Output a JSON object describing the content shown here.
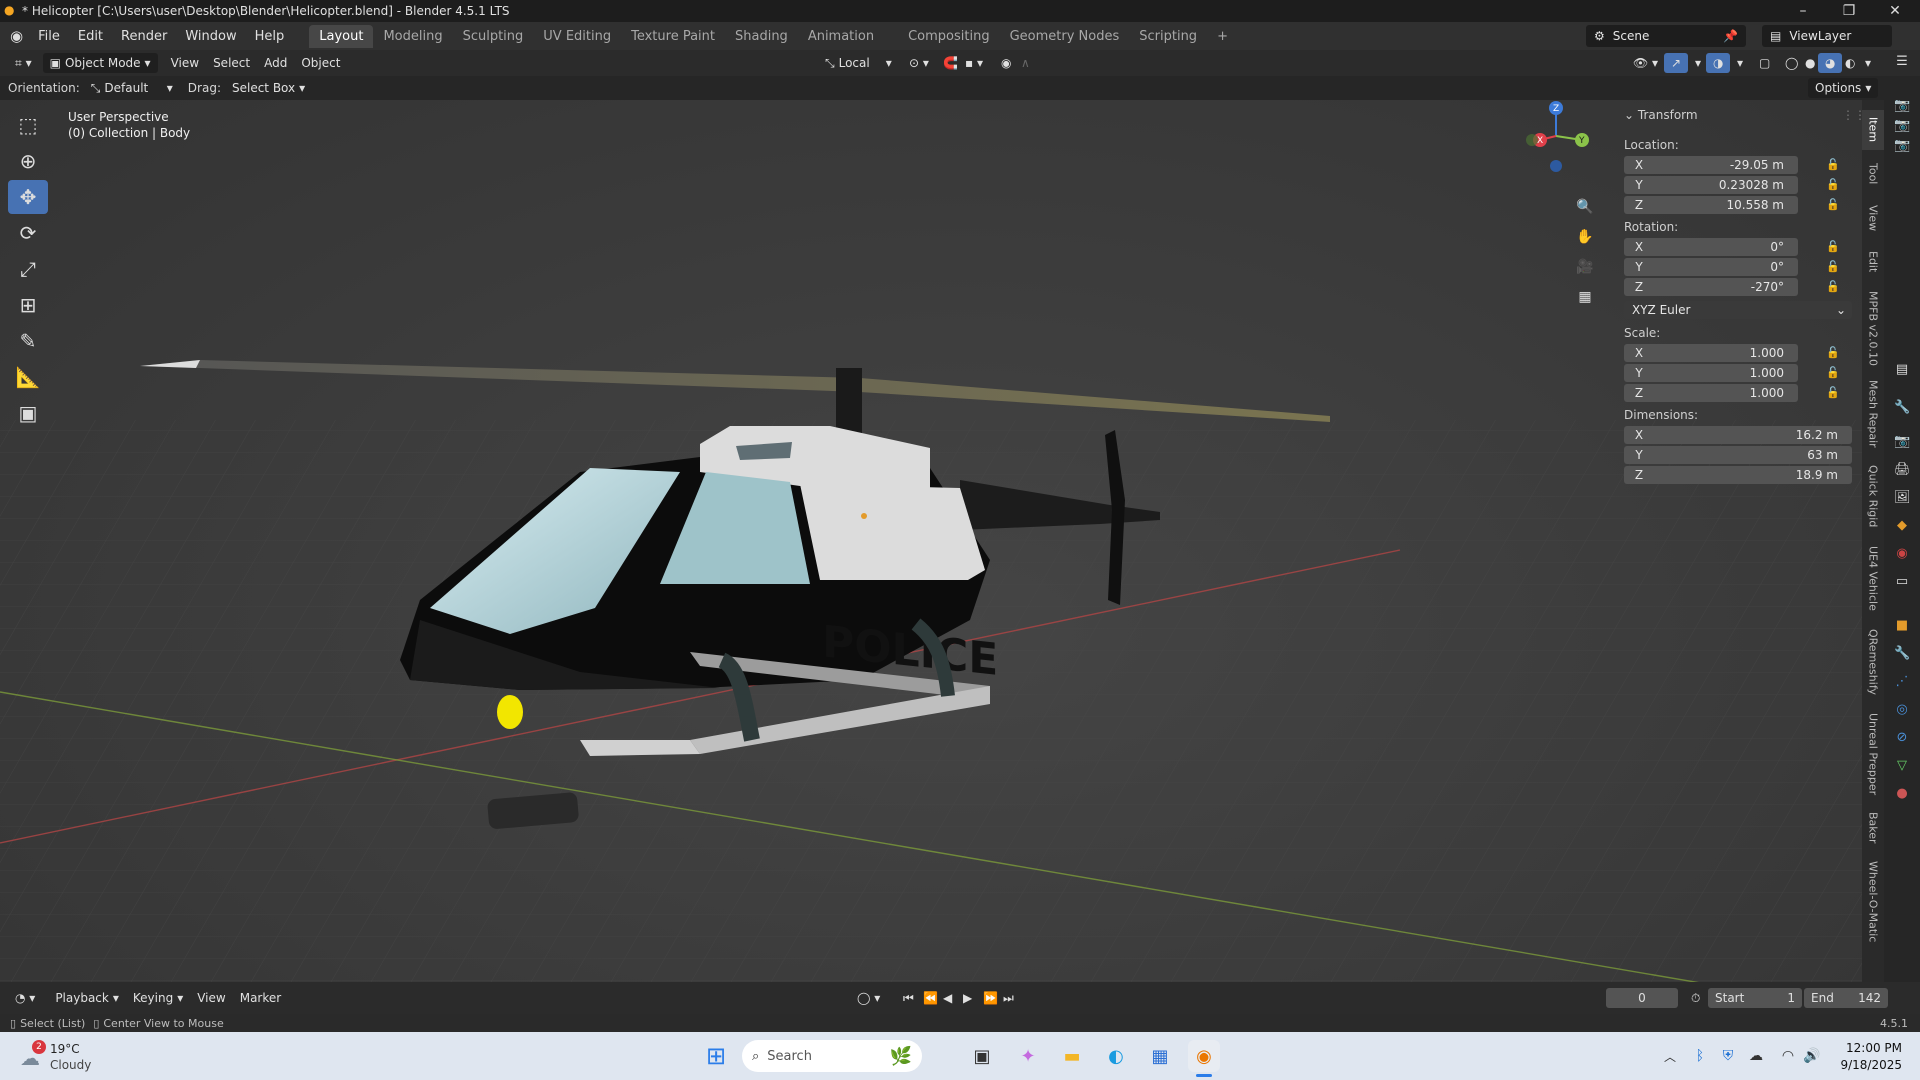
{
  "window": {
    "title": "* Helicopter [C:\\Users\\user\\Desktop\\Blender\\Helicopter.blend] - Blender 4.5.1 LTS"
  },
  "menu": [
    "File",
    "Edit",
    "Render",
    "Window",
    "Help"
  ],
  "workspaces": [
    "Layout",
    "Modeling",
    "Sculpting",
    "UV Editing",
    "Texture Paint",
    "Shading",
    "Animation",
    "Compositing",
    "Geometry Nodes",
    "Scripting"
  ],
  "active_workspace": "Layout",
  "scene": {
    "label": "Scene",
    "view_layer": "ViewLayer"
  },
  "header": {
    "mode": "Object Mode",
    "menus": [
      "View",
      "Select",
      "Add",
      "Object"
    ],
    "transform_orientation": "Local",
    "options": "Options"
  },
  "tool_header": {
    "orientation_label": "Orientation:",
    "orientation_value": "Default",
    "drag_label": "Drag:",
    "drag_value": "Select Box"
  },
  "viewport": {
    "perspective": "User Perspective",
    "collection": "(0) Collection | Body",
    "model_text": "POLICE",
    "gizmo": {
      "x": "X",
      "y": "Y",
      "z": "Z"
    }
  },
  "transform": {
    "title": "Transform",
    "location_label": "Location:",
    "location": [
      {
        "axis": "X",
        "value": "-29.05 m"
      },
      {
        "axis": "Y",
        "value": "0.23028 m"
      },
      {
        "axis": "Z",
        "value": "10.558 m"
      }
    ],
    "rotation_label": "Rotation:",
    "rotation": [
      {
        "axis": "X",
        "value": "0°"
      },
      {
        "axis": "Y",
        "value": "0°"
      },
      {
        "axis": "Z",
        "value": "-270°"
      }
    ],
    "rotation_mode": "XYZ Euler",
    "scale_label": "Scale:",
    "scale": [
      {
        "axis": "X",
        "value": "1.000"
      },
      {
        "axis": "Y",
        "value": "1.000"
      },
      {
        "axis": "Z",
        "value": "1.000"
      }
    ],
    "dimensions_label": "Dimensions:",
    "dimensions": [
      {
        "axis": "X",
        "value": "16.2 m"
      },
      {
        "axis": "Y",
        "value": "63 m"
      },
      {
        "axis": "Z",
        "value": "18.9 m"
      }
    ]
  },
  "side_tabs": [
    "Item",
    "Tool",
    "View",
    "Edit",
    "MPFB v2.0.10",
    "Mesh Repair",
    "Quick Rigid",
    "UE4 Vehicle",
    "QRemeshify",
    "Unreal Prepper",
    "Baker",
    "Wheel-O-Matic"
  ],
  "timeline": {
    "menus": [
      "Playback",
      "Keying",
      "View",
      "Marker"
    ],
    "current_frame": "0",
    "start_label": "Start",
    "start": "1",
    "end_label": "End",
    "end": "142"
  },
  "statusbar": {
    "left1": "Select (List)",
    "left2": "Center View to Mouse",
    "version": "4.5.1"
  },
  "taskbar": {
    "weather_temp": "19°C",
    "weather_desc": "Cloudy",
    "weather_badge": "2",
    "search": "Search",
    "time": "12:00 PM",
    "date": "9/18/2025"
  },
  "colors": {
    "accent": "#4772b3",
    "x_axis": "#e0404a",
    "y_axis": "#8bc34a",
    "z_axis": "#3d7bd9"
  }
}
